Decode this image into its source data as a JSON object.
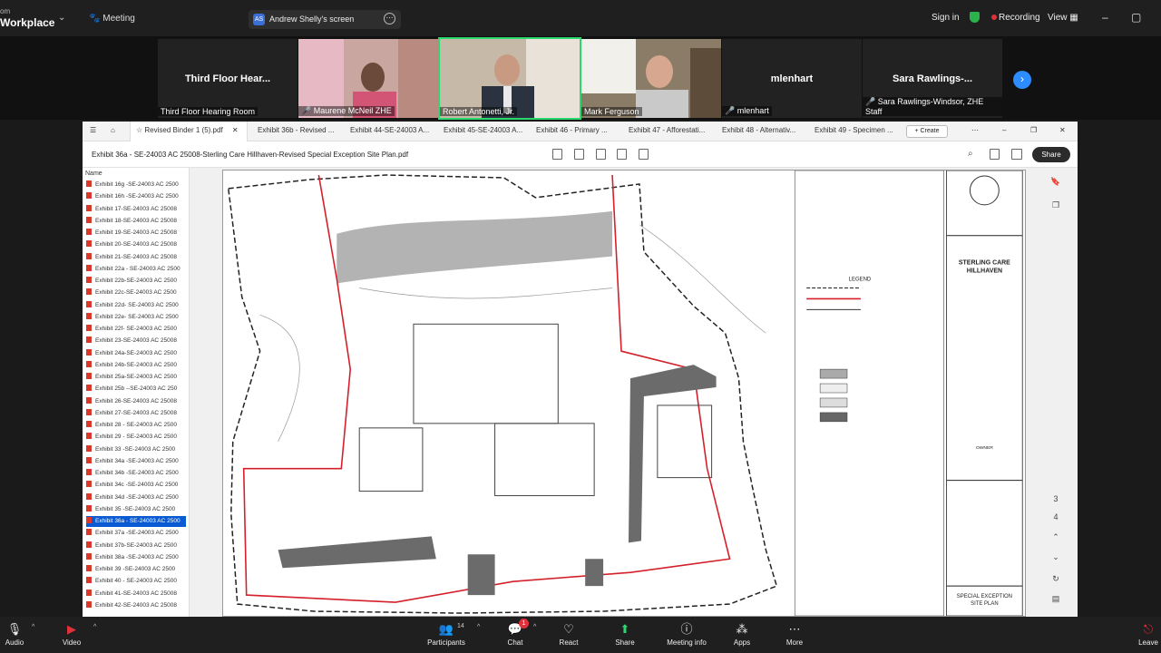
{
  "top": {
    "brand": "Workplace",
    "brand_top": "om",
    "meeting_label": "Meeting",
    "share_initials": "AS",
    "share_label": "Andrew Shelly's screen",
    "sign_in": "Sign in",
    "recording": "Recording",
    "view": "View"
  },
  "participants": [
    {
      "name": "Third Floor Hear...",
      "caption": "Third Floor Hearing Room",
      "video": false
    },
    {
      "name": "",
      "caption": "Maurene McNeil ZHE",
      "video": true
    },
    {
      "name": "",
      "caption": "Robert Antonetti, Jr.",
      "video": true
    },
    {
      "name": "",
      "caption": "Mark Ferguson",
      "video": true
    },
    {
      "name": "mlenhart",
      "caption": "mlenhart",
      "video": false
    },
    {
      "name": "Sara Rawlings-...",
      "caption": "Sara Rawlings-Windsor, ZHE Staff",
      "video": false
    }
  ],
  "viewer": {
    "tabs": [
      "Revised Binder 1 (5).pdf",
      "Exhibit 36b - Revised ...",
      "Exhibit 44-SE-24003 A...",
      "Exhibit 45-SE-24003 A...",
      "Exhibit 46 - Primary ...",
      "Exhibit 47 - Afforestati...",
      "Exhibit 48 - Alternativ...",
      "Exhibit 49 - Specimen ..."
    ],
    "create": "+ Create",
    "title": "Exhibit 36a - SE-24003 AC 25008-Sterling Care Hillhaven-Revised Special Exception Site Plan.pdf",
    "share": "Share",
    "sidebar_header": "Name",
    "files": [
      "Exhibit 16g -SE-24003 AC 2500",
      "Exhibit 16h -SE-24003 AC 2500",
      "Exhibit 17-SE-24003 AC 25008",
      "Exhibit 18-SE-24003 AC 25008",
      "Exhibit 19-SE-24003 AC 25008",
      "Exhibit 20-SE-24003 AC 25008",
      "Exhibit 21-SE-24003 AC 25008",
      "Exhibit 22a - SE-24003 AC 2500",
      "Exhibit 22b-SE-24003 AC 2500",
      "Exhibit 22c-SE-24003 AC 2500",
      "Exhibit 22d- SE-24003 AC 2500",
      "Exhibit 22e- SE-24003 AC 2500",
      "Exhibit 22f- SE-24003 AC 2500",
      "Exhibit 23-SE-24003 AC 25008",
      "Exhibit 24a-SE-24003 AC 2500",
      "Exhibit 24b-SE-24003 AC 2500",
      "Exhibit 25a-SE-24003 AC 2500",
      "Exhibit 25b --SE-24003 AC 250",
      "Exhibit 26-SE-24003 AC 25008",
      "Exhibit 27-SE-24003 AC 25008",
      "Exhibit 28 - SE-24003 AC 2500",
      "Exhibit 29 - SE-24003 AC 2500",
      "Exhibit 33 -SE-24003 AC 2500",
      "Exhibit 34a -SE-24003 AC 2500",
      "Exhibit 34b -SE-24003 AC 2500",
      "Exhibit 34c -SE-24003 AC 2500",
      "Exhibit 34d -SE-24003 AC 2500",
      "Exhibit 35 -SE-24003 AC 2500",
      "Exhibit 36a - SE-24003 AC 2500",
      "Exhibit 37a -SE-24003 AC 2500",
      "Exhibit 37b-SE-24003 AC 2500",
      "Exhibit 38a -SE-24003 AC 2500",
      "Exhibit 39 -SE-24003 AC 2500",
      "Exhibit 40 - SE-24003 AC 2500",
      "Exhibit 41-SE-24003 AC 25008",
      "Exhibit 42-SE-24003 AC 25008"
    ],
    "selected_index": 28,
    "plan": {
      "project": "STERLING CARE",
      "project2": "HILLHAVEN",
      "legend": "LEGEND",
      "owner": "OWNER",
      "sheet_title": "SPECIAL EXCEPTION",
      "sheet_title2": "SITE PLAN"
    },
    "page_numbers": [
      "3",
      "4"
    ]
  },
  "bottom": {
    "audio": "Audio",
    "video": "Video",
    "participants": "Participants",
    "participants_count": "14",
    "chat": "Chat",
    "chat_badge": "1",
    "react": "React",
    "share": "Share",
    "meeting_info": "Meeting info",
    "apps": "Apps",
    "more": "More",
    "leave": "Leave"
  },
  "colors": {
    "accent": "#2d8cff",
    "record": "#e0313b",
    "share_green": "#2bd86e",
    "plan_red": "#d4202a"
  }
}
